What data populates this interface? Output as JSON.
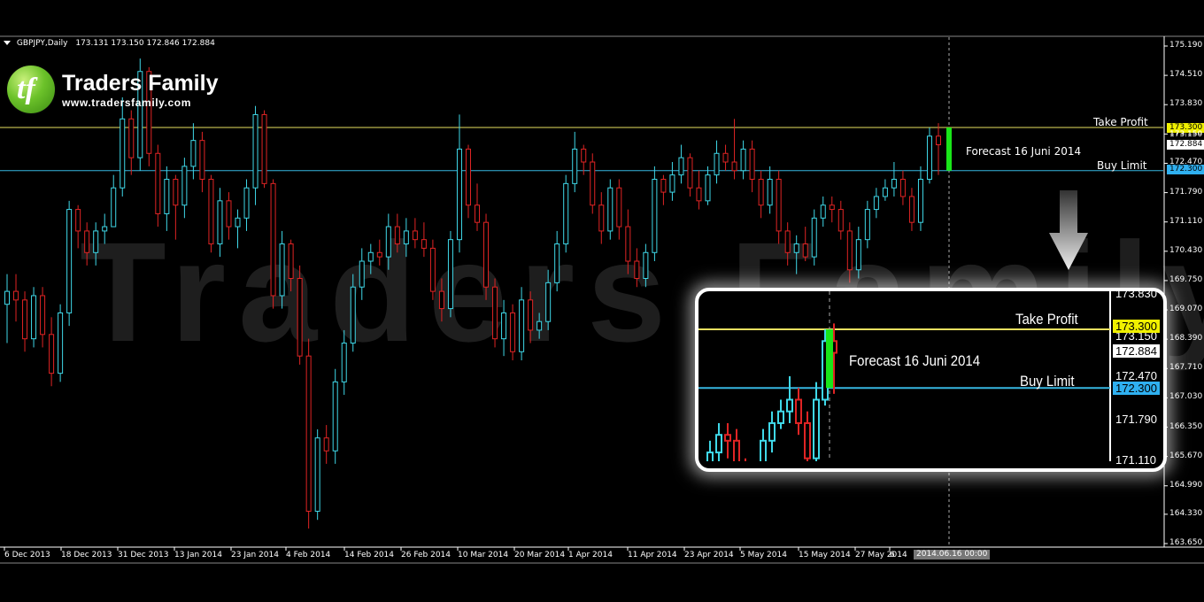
{
  "header": {
    "symbol": "GBPJPY,Daily",
    "ohlc": "173.131 173.150 172.846 172.884"
  },
  "brand": {
    "name": "Traders Family",
    "url": "www.tradersfamily.com",
    "watermark": "Traders Family",
    "logo_glyph": "tf"
  },
  "annotations": {
    "take_profit": "Take Profit",
    "buy_limit": "Buy Limit",
    "forecast": "Forecast 16 Juni 2014"
  },
  "colors": {
    "bull": "#3fd8e8",
    "bear": "#e02424",
    "forecast_candle": "#19e619",
    "take_profit_line": "#e8e060",
    "buy_limit_line": "#36b6e0",
    "take_profit_tag": "#f0f000",
    "buy_limit_tag": "#2fb0f0"
  },
  "chart_data": {
    "type": "candlestick",
    "symbol": "GBPJPY",
    "timeframe": "Daily",
    "ylim": [
      163.65,
      175.19
    ],
    "y_ticks": [
      "175.190",
      "174.510",
      "173.830",
      "173.150",
      "172.470",
      "171.790",
      "171.110",
      "170.430",
      "169.750",
      "169.070",
      "168.390",
      "167.710",
      "167.030",
      "166.350",
      "165.670",
      "164.990",
      "164.330",
      "163.650"
    ],
    "x_labels": [
      "6 Dec 2013",
      "18 Dec 2013",
      "31 Dec 2013",
      "13 Jan 2014",
      "23 Jan 2014",
      "4 Feb 2014",
      "14 Feb 2014",
      "26 Feb 2014",
      "10 Mar 2014",
      "20 Mar 2014",
      "1 Apr 2014",
      "11 Apr 2014",
      "23 Apr 2014",
      "5 May 2014",
      "15 May 2014",
      "27 May 2014",
      "6"
    ],
    "cursor_label": "2014.06.16 00:00",
    "levels": {
      "take_profit": 173.3,
      "buy_limit": 172.3,
      "take_profit_label": "173.300",
      "buy_limit_label": "172.300",
      "current_price_label": "172.884",
      "partial_label": "173.150"
    },
    "forecast": {
      "date": "16 Juni 2014",
      "open": 172.3,
      "close": 173.3
    },
    "candles_ohlc": [
      [
        169.2,
        169.9,
        168.3,
        169.5
      ],
      [
        169.5,
        169.9,
        168.8,
        169.3
      ],
      [
        169.3,
        169.5,
        168.1,
        168.4
      ],
      [
        168.4,
        169.6,
        168.2,
        169.4
      ],
      [
        169.4,
        169.6,
        168.2,
        168.5
      ],
      [
        168.5,
        168.9,
        167.3,
        167.6
      ],
      [
        167.6,
        169.2,
        167.4,
        169.0
      ],
      [
        169.0,
        171.6,
        168.7,
        171.4
      ],
      [
        171.4,
        171.5,
        170.5,
        170.9
      ],
      [
        170.9,
        171.1,
        170.1,
        170.4
      ],
      [
        170.4,
        171.1,
        170.1,
        170.9
      ],
      [
        170.9,
        171.3,
        170.6,
        171.0
      ],
      [
        171.0,
        172.2,
        171.0,
        171.9
      ],
      [
        171.9,
        174.0,
        171.7,
        173.5
      ],
      [
        173.5,
        173.7,
        172.2,
        172.6
      ],
      [
        172.6,
        174.9,
        172.3,
        174.6
      ],
      [
        174.6,
        174.7,
        172.4,
        172.7
      ],
      [
        172.7,
        172.9,
        171.0,
        171.3
      ],
      [
        171.3,
        172.4,
        170.9,
        172.1
      ],
      [
        172.1,
        172.2,
        170.7,
        171.5
      ],
      [
        171.5,
        172.6,
        171.2,
        172.4
      ],
      [
        172.4,
        173.4,
        172.1,
        173.0
      ],
      [
        173.0,
        173.2,
        171.8,
        172.1
      ],
      [
        172.1,
        172.2,
        170.4,
        170.6
      ],
      [
        170.6,
        171.9,
        170.3,
        171.6
      ],
      [
        171.6,
        171.8,
        170.7,
        171.0
      ],
      [
        171.0,
        171.4,
        170.5,
        171.2
      ],
      [
        171.2,
        172.1,
        170.9,
        171.9
      ],
      [
        171.9,
        173.8,
        171.5,
        173.6
      ],
      [
        173.6,
        173.7,
        171.9,
        172.0
      ],
      [
        172.0,
        172.1,
        169.1,
        169.4
      ],
      [
        169.4,
        170.9,
        169.1,
        170.6
      ],
      [
        170.6,
        170.7,
        169.5,
        169.8
      ],
      [
        169.8,
        170.1,
        167.8,
        168.0
      ],
      [
        168.0,
        168.4,
        164.0,
        164.4
      ],
      [
        164.4,
        166.3,
        164.2,
        166.1
      ],
      [
        166.1,
        166.4,
        165.5,
        165.8
      ],
      [
        165.8,
        167.7,
        165.5,
        167.4
      ],
      [
        167.4,
        168.6,
        167.1,
        168.3
      ],
      [
        168.3,
        169.9,
        168.1,
        169.6
      ],
      [
        169.6,
        170.5,
        169.3,
        170.2
      ],
      [
        170.2,
        170.6,
        169.9,
        170.4
      ],
      [
        170.4,
        170.7,
        170.1,
        170.3
      ],
      [
        170.3,
        171.3,
        170.0,
        171.0
      ],
      [
        171.0,
        171.3,
        170.4,
        170.6
      ],
      [
        170.6,
        171.2,
        170.3,
        170.9
      ],
      [
        170.9,
        171.2,
        170.5,
        170.7
      ],
      [
        170.7,
        171.1,
        170.3,
        170.5
      ],
      [
        170.5,
        170.7,
        169.3,
        169.5
      ],
      [
        169.5,
        169.8,
        168.8,
        169.1
      ],
      [
        169.1,
        170.9,
        168.9,
        170.7
      ],
      [
        170.7,
        173.6,
        170.4,
        172.8
      ],
      [
        172.8,
        172.9,
        171.2,
        171.5
      ],
      [
        171.5,
        172.0,
        170.9,
        171.1
      ],
      [
        171.1,
        171.3,
        169.3,
        169.6
      ],
      [
        169.6,
        169.8,
        168.2,
        168.4
      ],
      [
        168.4,
        169.3,
        168.0,
        169.0
      ],
      [
        169.0,
        169.2,
        167.9,
        168.1
      ],
      [
        168.1,
        169.6,
        167.9,
        169.3
      ],
      [
        169.3,
        169.5,
        168.3,
        168.6
      ],
      [
        168.6,
        169.0,
        168.4,
        168.8
      ],
      [
        168.8,
        170.0,
        168.6,
        169.7
      ],
      [
        169.7,
        170.9,
        169.5,
        170.6
      ],
      [
        170.6,
        172.2,
        170.4,
        172.0
      ],
      [
        172.0,
        173.2,
        171.8,
        172.8
      ],
      [
        172.8,
        172.9,
        172.2,
        172.5
      ],
      [
        172.5,
        172.7,
        171.3,
        171.5
      ],
      [
        171.5,
        171.8,
        170.6,
        170.9
      ],
      [
        170.9,
        172.1,
        170.7,
        171.9
      ],
      [
        171.9,
        172.1,
        170.7,
        171.0
      ],
      [
        171.0,
        171.4,
        169.9,
        170.2
      ],
      [
        170.2,
        170.5,
        169.6,
        169.8
      ],
      [
        169.8,
        170.6,
        169.6,
        170.4
      ],
      [
        170.4,
        172.4,
        170.2,
        172.1
      ],
      [
        172.1,
        172.2,
        171.5,
        171.8
      ],
      [
        171.8,
        172.5,
        171.6,
        172.2
      ],
      [
        172.2,
        172.9,
        172.0,
        172.6
      ],
      [
        172.6,
        172.7,
        171.7,
        171.9
      ],
      [
        171.9,
        172.3,
        171.4,
        171.6
      ],
      [
        171.6,
        172.4,
        171.5,
        172.2
      ],
      [
        172.2,
        173.0,
        172.0,
        172.7
      ],
      [
        172.7,
        172.9,
        172.3,
        172.5
      ],
      [
        172.5,
        173.5,
        172.1,
        172.3
      ],
      [
        172.3,
        173.0,
        172.1,
        172.8
      ],
      [
        172.8,
        173.0,
        171.8,
        172.1
      ],
      [
        172.1,
        172.3,
        171.2,
        171.5
      ],
      [
        171.5,
        172.4,
        171.3,
        172.1
      ],
      [
        172.1,
        172.3,
        170.6,
        170.9
      ],
      [
        170.9,
        171.1,
        170.1,
        170.4
      ],
      [
        170.4,
        170.8,
        169.9,
        170.6
      ],
      [
        170.6,
        171.0,
        170.2,
        170.3
      ],
      [
        170.3,
        171.4,
        170.1,
        171.2
      ],
      [
        171.2,
        171.7,
        171.0,
        171.5
      ],
      [
        171.5,
        171.7,
        171.1,
        171.4
      ],
      [
        171.4,
        171.6,
        170.7,
        170.9
      ],
      [
        170.9,
        171.1,
        169.7,
        170.0
      ],
      [
        170.0,
        171.0,
        169.8,
        170.7
      ],
      [
        170.7,
        171.6,
        170.5,
        171.4
      ],
      [
        171.4,
        171.9,
        171.2,
        171.7
      ],
      [
        171.7,
        172.1,
        171.6,
        171.9
      ],
      [
        171.9,
        172.5,
        171.7,
        172.1
      ],
      [
        172.1,
        172.3,
        171.5,
        171.7
      ],
      [
        171.7,
        171.9,
        170.9,
        171.1
      ],
      [
        171.1,
        172.4,
        170.9,
        172.1
      ],
      [
        172.1,
        173.3,
        172.0,
        173.1
      ],
      [
        173.1,
        173.4,
        172.2,
        172.9
      ]
    ]
  }
}
